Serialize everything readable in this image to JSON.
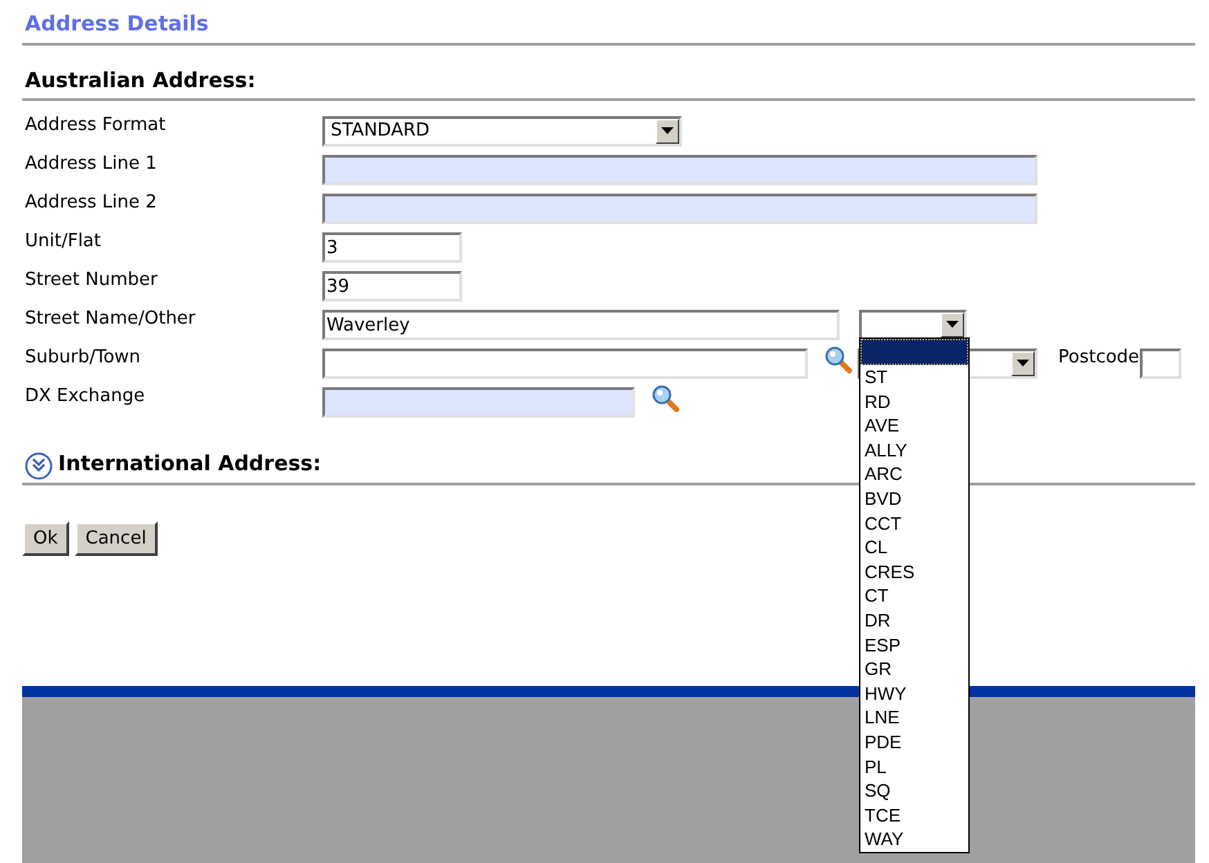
{
  "title": "Address Details",
  "australian": {
    "heading": "Australian Address:",
    "rows": [
      {
        "label": "Address Format",
        "kind": "select",
        "value": "STANDARD"
      },
      {
        "label": "Address Line 1",
        "kind": "wide_text",
        "mandatory": true
      },
      {
        "label": "Address Line 2",
        "kind": "wide_text",
        "mandatory": true
      },
      {
        "label": "Unit/Flat",
        "kind": "narrow_text",
        "mandatory": false,
        "value": "3"
      },
      {
        "label": "Street Number",
        "kind": "narrow_text",
        "mandatory": false,
        "value": "39"
      },
      {
        "label": "Street Name/Other",
        "kind": "street",
        "value": "Waverley",
        "type_dropdown": {
          "expanded": true,
          "blank_option_highlighted": true,
          "options": [
            "ST",
            "RD",
            "AVE",
            "ALLY",
            "ARC",
            "BVD",
            "CCT",
            "CL",
            "CRES",
            "CT",
            "DR",
            "ESP",
            "GR",
            "HWY",
            "LNE",
            "PDE",
            "PL",
            "SQ",
            "TCE",
            "WAY"
          ]
        }
      },
      {
        "label": "Suburb/Town",
        "kind": "suburb",
        "postcode_label": "Postcode"
      },
      {
        "label": "DX Exchange",
        "kind": "lookup",
        "mandatory": true
      }
    ]
  },
  "international": {
    "heading": "International Address:",
    "expanded": false
  },
  "buttons": [
    "Ok",
    "Cancel"
  ]
}
